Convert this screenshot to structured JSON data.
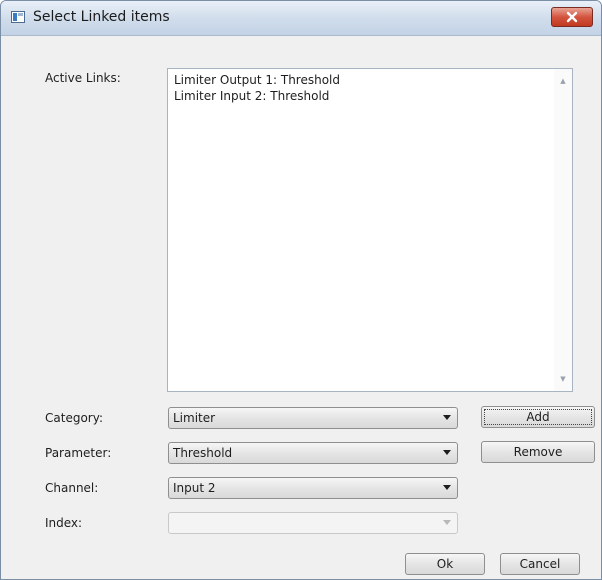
{
  "window": {
    "title": "Select Linked items",
    "close_icon": "close-icon",
    "app_icon": "dialog-icon"
  },
  "active_links": {
    "label": "Active Links:",
    "items": [
      "Limiter Output 1: Threshold",
      "Limiter Input 2: Threshold"
    ]
  },
  "category": {
    "label": "Category:",
    "value": "Limiter"
  },
  "parameter": {
    "label": "Parameter:",
    "value": "Threshold"
  },
  "channel": {
    "label": "Channel:",
    "value": "Input 2"
  },
  "index": {
    "label": "Index:",
    "value": ""
  },
  "buttons": {
    "add": "Add",
    "remove": "Remove",
    "ok": "Ok",
    "cancel": "Cancel"
  },
  "colors": {
    "close_button": "#c1391f",
    "titlebar": "#cfdceb"
  }
}
